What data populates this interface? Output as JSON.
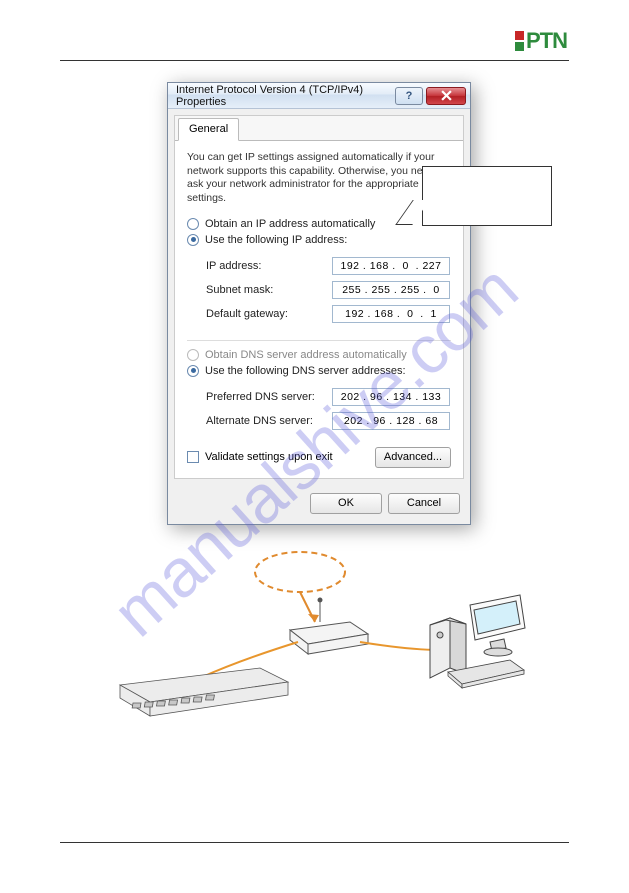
{
  "logo": {
    "text": "PTN"
  },
  "watermark": "manualshive.com",
  "dialog": {
    "title": "Internet Protocol Version 4 (TCP/IPv4) Properties",
    "help_label": "?",
    "close_label": "X",
    "tab_general": "General",
    "info": "You can get IP settings assigned automatically if your network supports this capability. Otherwise, you need to ask your network administrator for the appropriate IP settings.",
    "radio_obtain_ip": "Obtain an IP address automatically",
    "radio_use_ip": "Use the following IP address:",
    "ip_address_label": "IP address:",
    "ip_address_value": "192 . 168 .  0  . 227",
    "subnet_label": "Subnet mask:",
    "subnet_value": "255 . 255 . 255 .  0",
    "gateway_label": "Default gateway:",
    "gateway_value": "192 . 168 .  0  .  1",
    "radio_obtain_dns": "Obtain DNS server address automatically",
    "radio_use_dns": "Use the following DNS server addresses:",
    "pref_dns_label": "Preferred DNS server:",
    "pref_dns_value": "202 . 96 . 134 . 133",
    "alt_dns_label": "Alternate DNS server:",
    "alt_dns_value": "202 . 96 . 128 . 68",
    "validate_label": "Validate settings upon exit",
    "advanced_label": "Advanced...",
    "ok_label": "OK",
    "cancel_label": "Cancel"
  }
}
